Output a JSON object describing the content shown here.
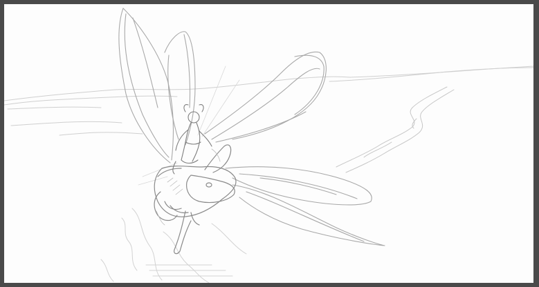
{
  "colors": {
    "frame": "#4a4a4a",
    "canvas": "#fdfdfd",
    "stroke_dark": "#8a8a8a",
    "stroke_mid": "#a8a8a8",
    "stroke_light": "#cfcfcf"
  },
  "icons": [
    "pencil-sketch-artwork"
  ]
}
